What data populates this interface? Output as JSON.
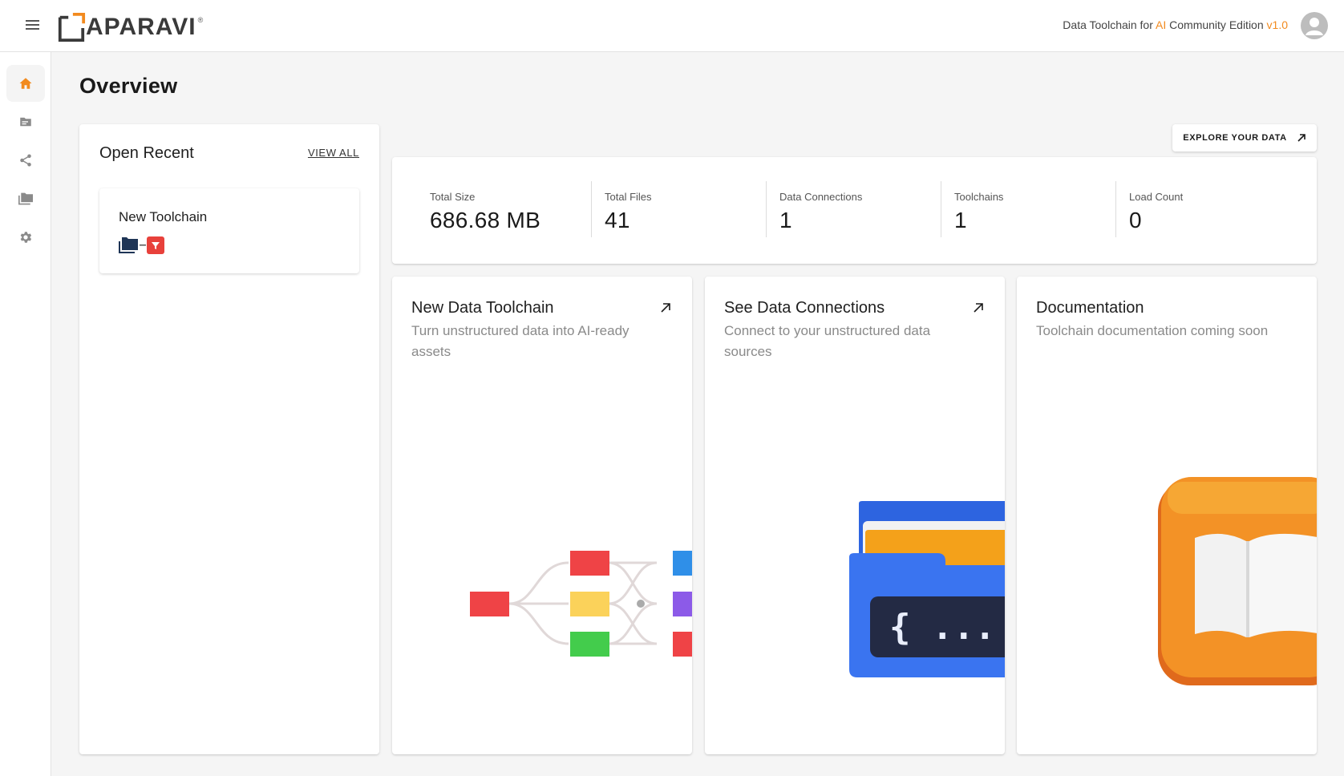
{
  "header": {
    "logo_text": "APARAVI",
    "logo_reg": "®",
    "edition_prefix": "Data Toolchain for ",
    "edition_ai": "AI",
    "edition_middle": " Community Edition ",
    "edition_version": "v1.0"
  },
  "colors": {
    "accent": "#f28a1e",
    "sidebar_active_icon": "#f28a1e",
    "sidebar_icon": "#8a8a8a"
  },
  "sidebar": {
    "items": [
      {
        "icon": "home-icon",
        "active": true
      },
      {
        "icon": "file-list-icon",
        "active": false
      },
      {
        "icon": "share-icon",
        "active": false
      },
      {
        "icon": "folders-icon",
        "active": false
      },
      {
        "icon": "gear-icon",
        "active": false
      }
    ]
  },
  "main": {
    "title": "Overview",
    "recent": {
      "title": "Open Recent",
      "view_all": "VIEW ALL",
      "items": [
        {
          "name": "New Toolchain",
          "icons": [
            "folder-icon",
            "filter-icon"
          ]
        }
      ]
    },
    "explore_button": "EXPLORE YOUR DATA",
    "stats": [
      {
        "label": "Total Size",
        "value": "686.68 MB"
      },
      {
        "label": "Total Files",
        "value": "41"
      },
      {
        "label": "Data Connections",
        "value": "1"
      },
      {
        "label": "Toolchains",
        "value": "1"
      },
      {
        "label": "Load Count",
        "value": "0"
      }
    ],
    "features": [
      {
        "title": "New Data Toolchain",
        "subtitle": "Turn unstructured data into AI-ready assets",
        "illustration": "toolchain-graph"
      },
      {
        "title": "See Data Connections",
        "subtitle": "Connect to your unstructured data sources",
        "illustration": "code-folder"
      },
      {
        "title": "Documentation",
        "subtitle": "Toolchain documentation coming soon",
        "illustration": "book"
      }
    ]
  }
}
